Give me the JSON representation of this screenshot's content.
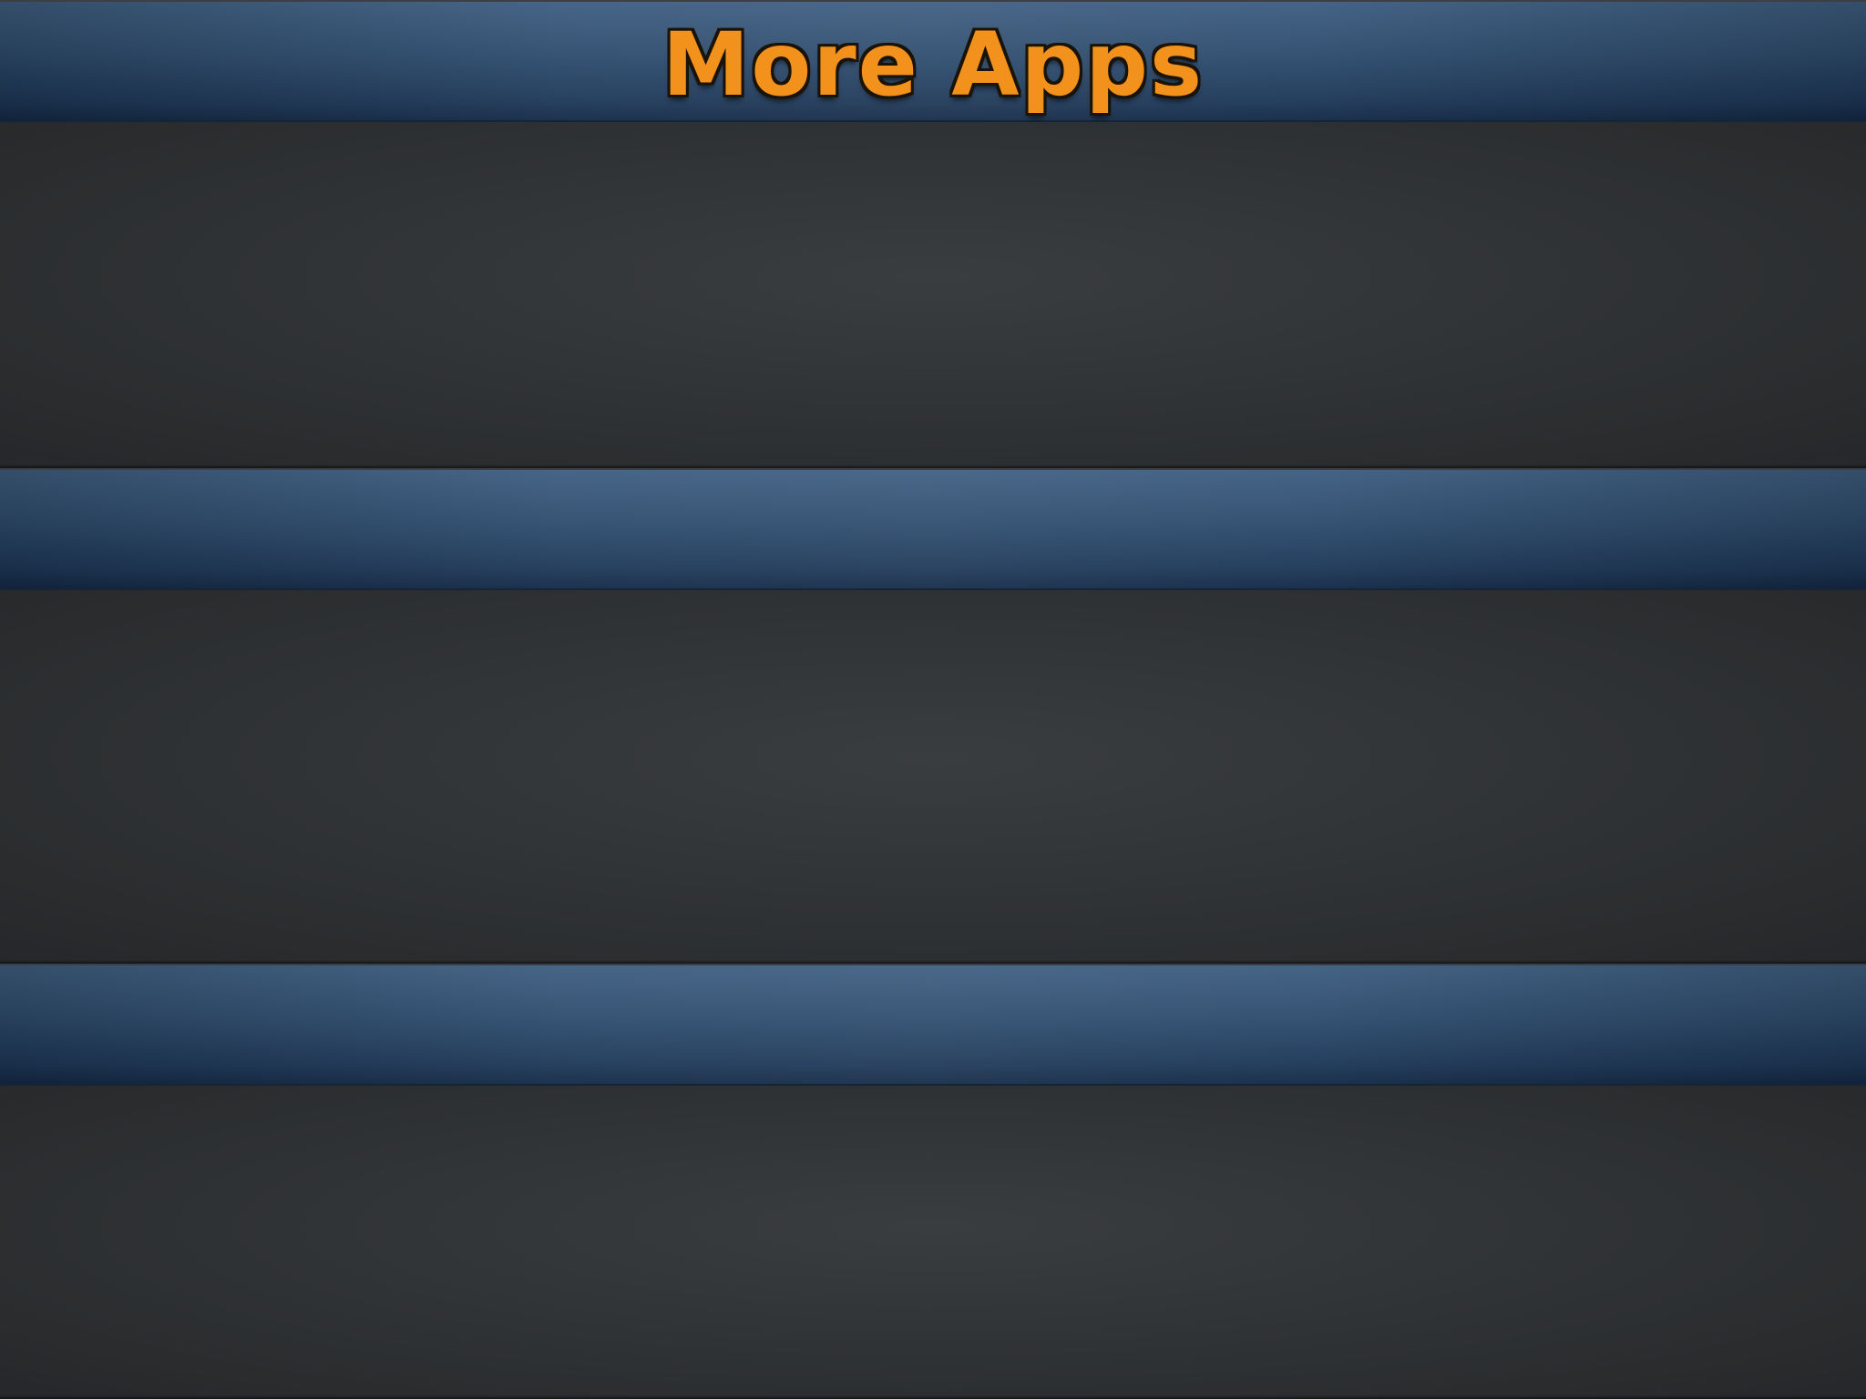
{
  "header": {
    "title": "More Apps"
  },
  "theme": {
    "bar_color": "#2f4d6f",
    "background_color": "#2e3134",
    "title_color": "#f2911c"
  }
}
